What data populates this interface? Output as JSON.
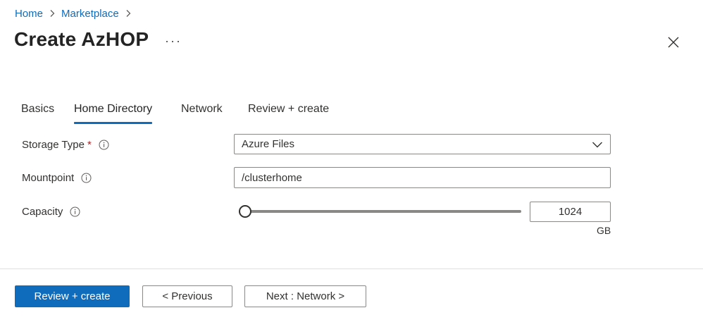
{
  "breadcrumb": {
    "items": [
      {
        "label": "Home"
      },
      {
        "label": "Marketplace"
      }
    ]
  },
  "header": {
    "title": "Create AzHOP",
    "more_icon": "more-horizontal-icon",
    "close_icon": "close-icon"
  },
  "tabs": [
    {
      "label": "Basics",
      "active": false
    },
    {
      "label": "Home Directory",
      "active": true
    },
    {
      "label": "Network",
      "active": false
    },
    {
      "label": "Review + create",
      "active": false
    }
  ],
  "form": {
    "storage_type": {
      "label": "Storage Type",
      "required_marker": "*",
      "value": "Azure Files"
    },
    "mountpoint": {
      "label": "Mountpoint",
      "value": "/clusterhome"
    },
    "capacity": {
      "label": "Capacity",
      "value": "1024",
      "unit": "GB",
      "slider_fraction": 0.0
    }
  },
  "footer": {
    "review_create_label": "Review + create",
    "previous_label": "< Previous",
    "next_label": "Next : Network >"
  },
  "colors": {
    "accent": "#0f6cbd",
    "required": "#a4262c",
    "text": "#323130",
    "border": "#8a8886"
  }
}
